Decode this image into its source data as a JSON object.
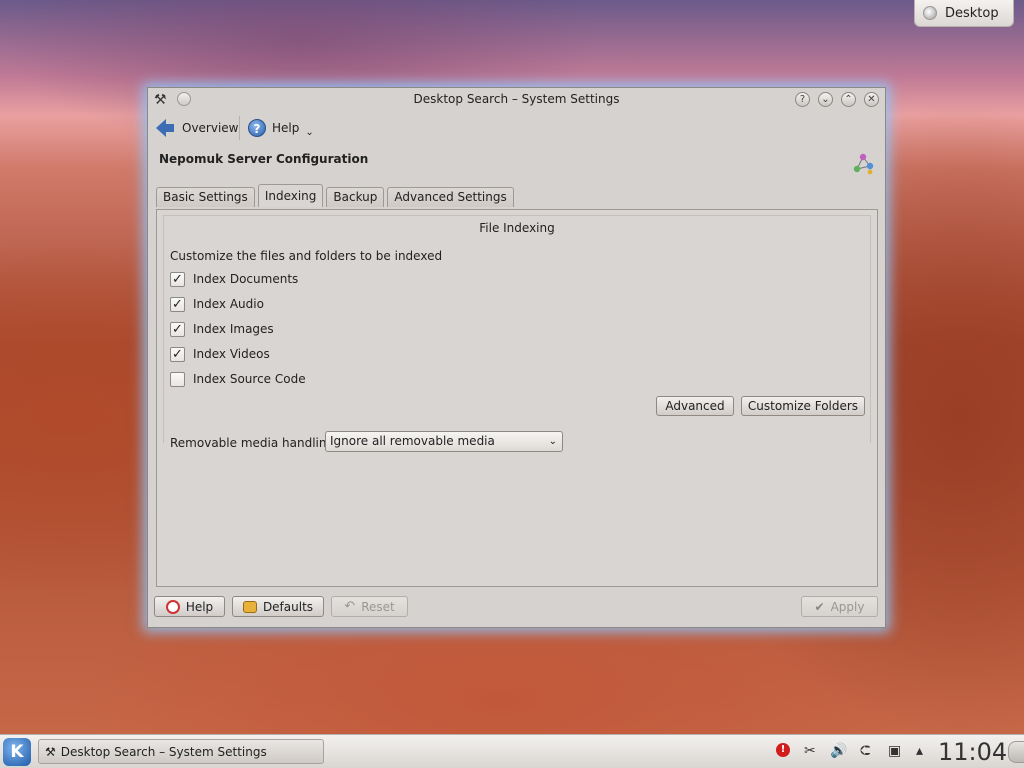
{
  "desktop": {
    "cashew_label": "Desktop"
  },
  "window": {
    "title": "Desktop Search – System Settings",
    "toolbar": {
      "overview_label": "Overview",
      "help_label": "Help",
      "help_caret": "⌄"
    },
    "heading": "Nepomuk Server Configuration",
    "tabs": [
      {
        "label": "Basic Settings"
      },
      {
        "label": "Indexing"
      },
      {
        "label": "Backup"
      },
      {
        "label": "Advanced Settings"
      }
    ],
    "panel": {
      "group_title": "File Indexing",
      "description": "Customize the files and folders to be indexed",
      "checkboxes": [
        {
          "label": "Index Documents",
          "checked": true
        },
        {
          "label": "Index Audio",
          "checked": true
        },
        {
          "label": "Index Images",
          "checked": true
        },
        {
          "label": "Index Videos",
          "checked": true
        },
        {
          "label": "Index Source Code",
          "checked": false
        }
      ],
      "advanced_label": "Advanced",
      "customize_folders_label": "Customize Folders",
      "removable_label": "Removable media handling:",
      "removable_value": "Ignore all removable media"
    },
    "buttons": {
      "help": "Help",
      "defaults": "Defaults",
      "reset": "Reset",
      "apply": "Apply"
    }
  },
  "taskbar": {
    "kmenu_glyph": "K",
    "task_label": "Desktop Search – System Settings",
    "tray_alert_glyph": "!",
    "tray_clipboard_glyph": "✂",
    "tray_volume_glyph": "🔊",
    "tray_device_glyph": "⮈",
    "tray_network_glyph": "▣",
    "tray_expand_glyph": "▴",
    "clock": "11:04"
  },
  "icons": {
    "window_app": "tools-icon",
    "check_mark": "✓"
  },
  "colors": {
    "window_glow": "#8cc8ff",
    "kmenu": "#1e5aa8",
    "alert": "#d21d1d"
  }
}
